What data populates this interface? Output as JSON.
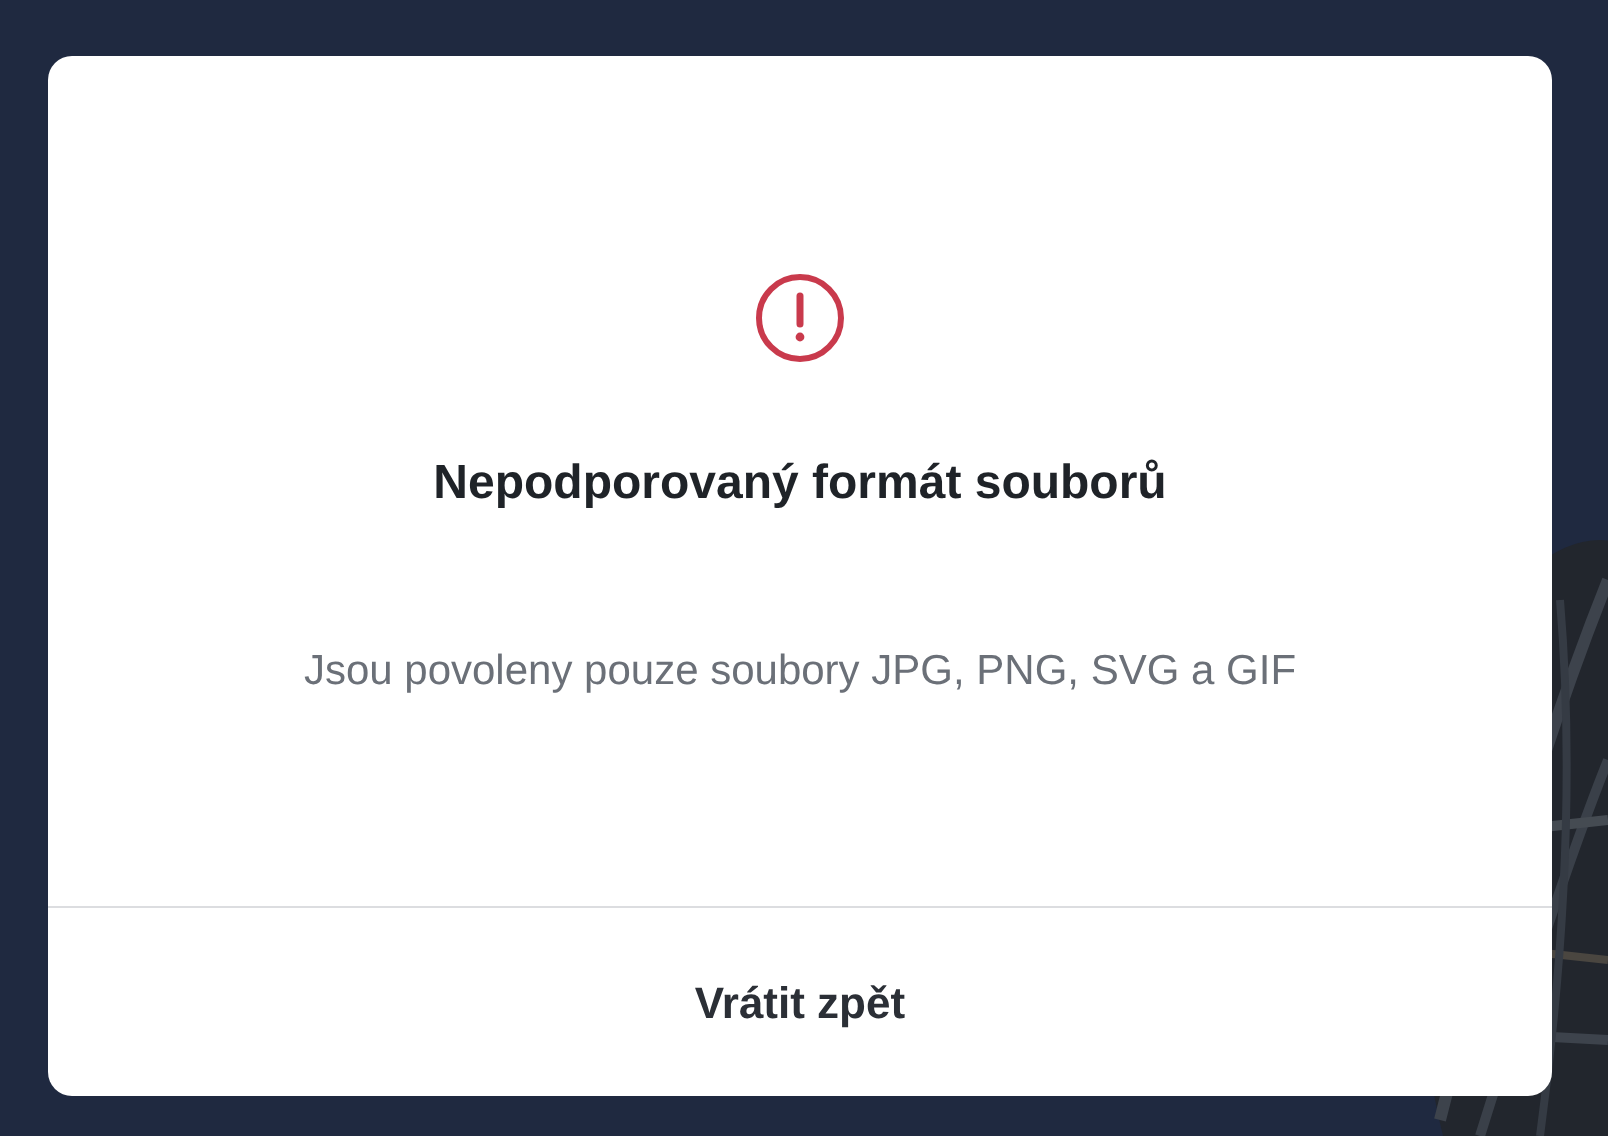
{
  "dialog": {
    "title": "Nepodporovaný formát souborů",
    "message": "Jsou povoleny pouze soubory JPG, PNG, SVG a GIF",
    "button": "Vrátit zpět"
  }
}
